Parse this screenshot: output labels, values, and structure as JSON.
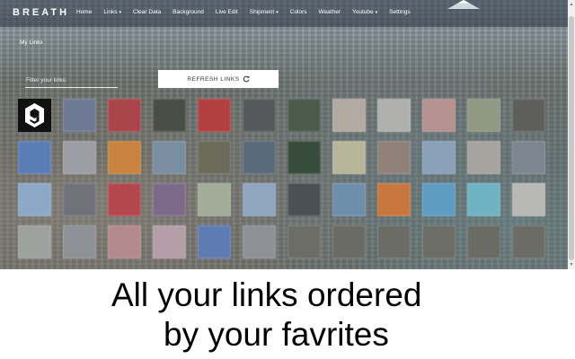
{
  "brand": "BREATH",
  "nav": [
    {
      "label": "Home",
      "caret": false
    },
    {
      "label": "Links",
      "caret": true
    },
    {
      "label": "Clear Data",
      "caret": false
    },
    {
      "label": "Background",
      "caret": false
    },
    {
      "label": "Live Edit",
      "caret": false
    },
    {
      "label": "Shipment",
      "caret": true
    },
    {
      "label": "Colors",
      "caret": false
    },
    {
      "label": "Weather",
      "caret": false
    },
    {
      "label": "Youtube",
      "caret": true
    },
    {
      "label": "Settings",
      "caret": false
    }
  ],
  "section_title": "My Links",
  "filter": {
    "placeholder": "Filter your links:",
    "value": ""
  },
  "refresh_label": "REFRESH LINKS",
  "icons": {
    "refresh": "refresh-icon",
    "logo": "9gag-logo-icon",
    "caret": "caret-down-icon"
  },
  "tiles": [
    "9gag-logo",
    "#6e7a93",
    "#a9454a",
    "#4a4d43",
    "#b34040",
    "#55595b",
    "#4b5a4b",
    "#b2a9a2",
    "#b0b0ae",
    "#b59290",
    "#8f9983",
    "#5e5f5b",
    "#5a7db5",
    "#9d9ea4",
    "#c7833f",
    "#7a8ea2",
    "#6b6b5a",
    "#5a6a7a",
    "#384c3b",
    "#b7b69a",
    "#8f8178",
    "#8aa0b8",
    "#a5a4a0",
    "#7d8590",
    "#8ea9c8",
    "#6f7278",
    "#b3474e",
    "#7d6a8a",
    "#a3ab99",
    "#8fa5c0",
    "#4a5056",
    "#6e8fab",
    "#c8783e",
    "#5f9cc4",
    "#6fb2c4",
    "#b8b8b5",
    "#9ea29e",
    "#8e9296",
    "#b38a8e",
    "#b59ea8",
    "#5e7bb4",
    "#8e9196",
    "#6c6d66",
    "#6a6b64",
    "#6b6c66",
    "#6c6d67",
    "#6a6b65",
    "#6b6c66"
  ],
  "caption": {
    "line1": "All your links ordered",
    "line2": "by your favrites"
  }
}
